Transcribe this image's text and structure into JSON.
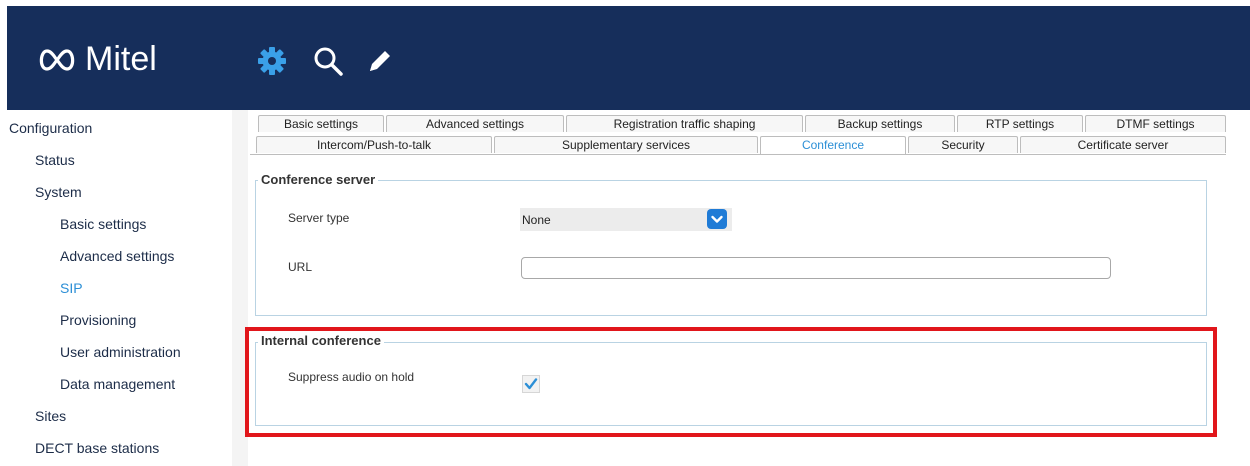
{
  "header": {
    "brand": "Mitel",
    "icons": [
      "gear-icon",
      "search-icon",
      "pencil-icon"
    ],
    "bg_color": "#162e5b"
  },
  "sidebar": {
    "items": [
      {
        "label": "Configuration"
      },
      {
        "label": "Status"
      },
      {
        "label": "System"
      },
      {
        "label": "Basic settings"
      },
      {
        "label": "Advanced settings"
      },
      {
        "label": "SIP",
        "active": true
      },
      {
        "label": "Provisioning"
      },
      {
        "label": "User administration"
      },
      {
        "label": "Data management"
      },
      {
        "label": "Sites"
      },
      {
        "label": "DECT base stations"
      }
    ],
    "active_color": "#2c8fd6"
  },
  "tabs": {
    "row1": [
      "Basic settings",
      "Advanced settings",
      "Registration traffic shaping",
      "Backup settings",
      "RTP settings",
      "DTMF settings"
    ],
    "row2": [
      "Intercom/Push-to-talk",
      "Supplementary services",
      "Conference",
      "Security",
      "Certificate server"
    ],
    "active": "Conference"
  },
  "conference_server": {
    "legend": "Conference server",
    "server_type_label": "Server type",
    "server_type_value": "None",
    "url_label": "URL",
    "url_value": ""
  },
  "internal_conference": {
    "legend": "Internal conference",
    "suppress_label": "Suppress audio on hold",
    "suppress_checked": true
  },
  "highlight_color": "#e1161b"
}
